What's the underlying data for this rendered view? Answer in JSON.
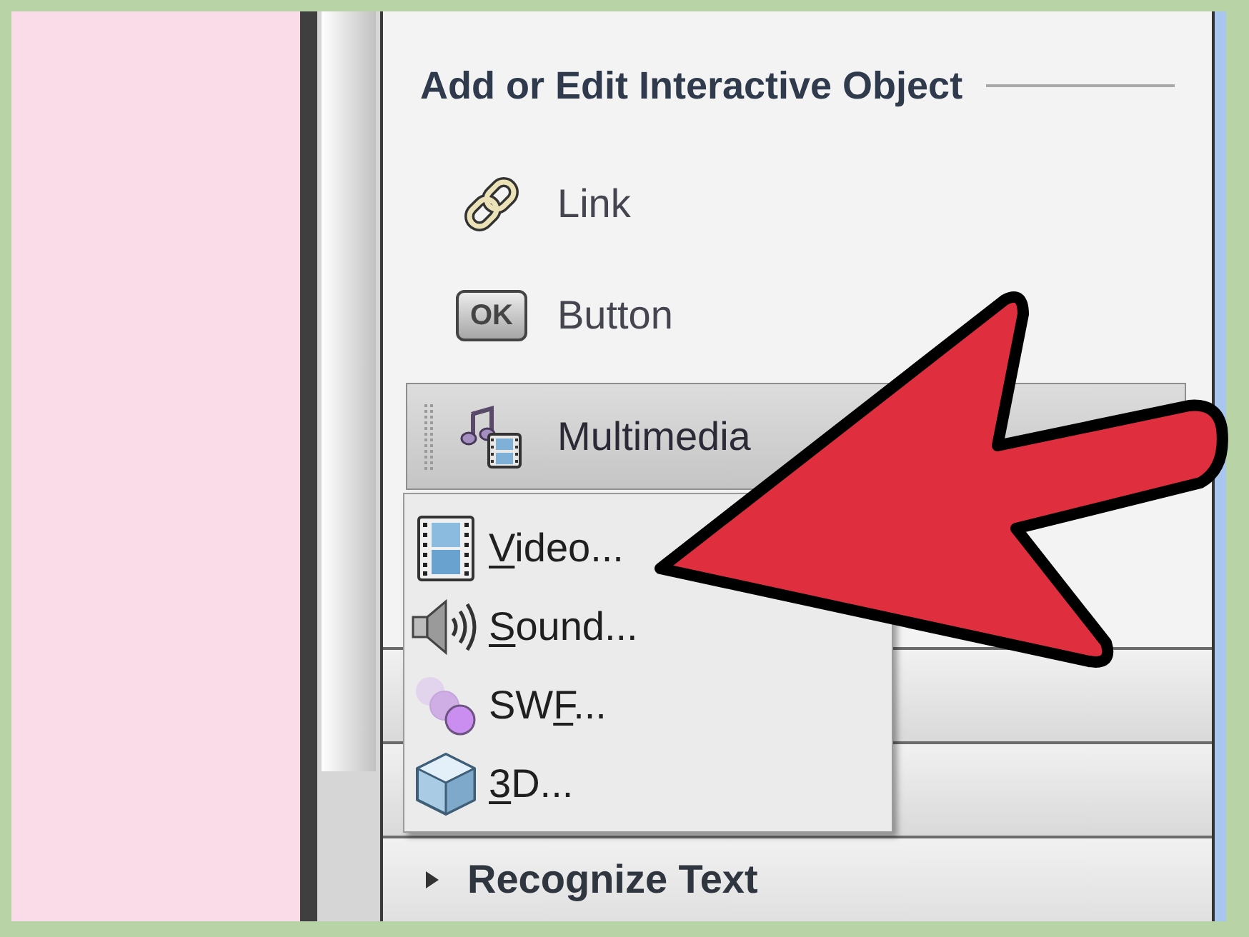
{
  "panel": {
    "title": "Add or Edit Interactive Object"
  },
  "tools": [
    {
      "kind": "link",
      "label": "Link",
      "expanded": false
    },
    {
      "kind": "button",
      "label": "Button",
      "badge": "OK",
      "expanded": false
    },
    {
      "kind": "multimedia",
      "label": "Multimedia",
      "expanded": true,
      "menu": [
        {
          "kind": "video",
          "key": "V",
          "after": "ideo..."
        },
        {
          "kind": "sound",
          "key": "S",
          "after": "ound..."
        },
        {
          "kind": "swf",
          "before": "SW",
          "key": "F",
          "after": "..."
        },
        {
          "kind": "model",
          "key": "3",
          "after": "D..."
        }
      ]
    }
  ],
  "sections": [
    {
      "label": "Recognize Text",
      "expanded": false
    }
  ]
}
